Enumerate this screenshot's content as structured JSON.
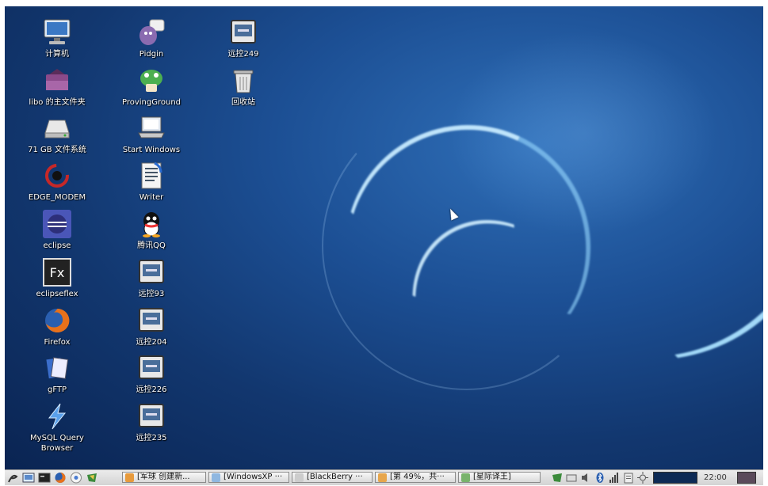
{
  "desktop_icons": {
    "computer": "计算机",
    "home_folder": "libo 的主文件夹",
    "filesystem": "71 GB 文件系统",
    "edge_modem": "EDGE_MODEM",
    "eclipse": "eclipse",
    "eclipseflex": "eclipseflex",
    "firefox": "Firefox",
    "gftp": "gFTP",
    "mysql_query_browser": "MySQL Query Browser",
    "pidgin": "Pidgin",
    "proving_ground": "ProvingGround",
    "start_windows": "Start Windows",
    "writer": "Writer",
    "qq": "腾讯QQ",
    "remote93": "远控93",
    "remote204": "远控204",
    "remote226": "远控226",
    "remote235": "远控235",
    "remote249": "远控249",
    "trash": "回收站"
  },
  "taskbar": {
    "tasks": [
      "[军球 创建新...",
      "[WindowsXP ···",
      "[BlackBerry ···",
      "[第 49%，共···",
      "[星际译王]"
    ],
    "clock": "22:00"
  },
  "icon_names": [
    "computer-icon",
    "home-folder-icon",
    "drive-icon",
    "modem-icon",
    "eclipse-icon",
    "flex-icon",
    "firefox-icon",
    "gftp-icon",
    "mysql-icon",
    "pidgin-icon",
    "proving-ground-icon",
    "laptop-icon",
    "writer-icon",
    "qq-icon",
    "remote-desktop-icon",
    "trash-icon"
  ],
  "colors": {
    "desktop_bg": "#1c4f94",
    "taskbar_bg": "#dcdcdc"
  }
}
